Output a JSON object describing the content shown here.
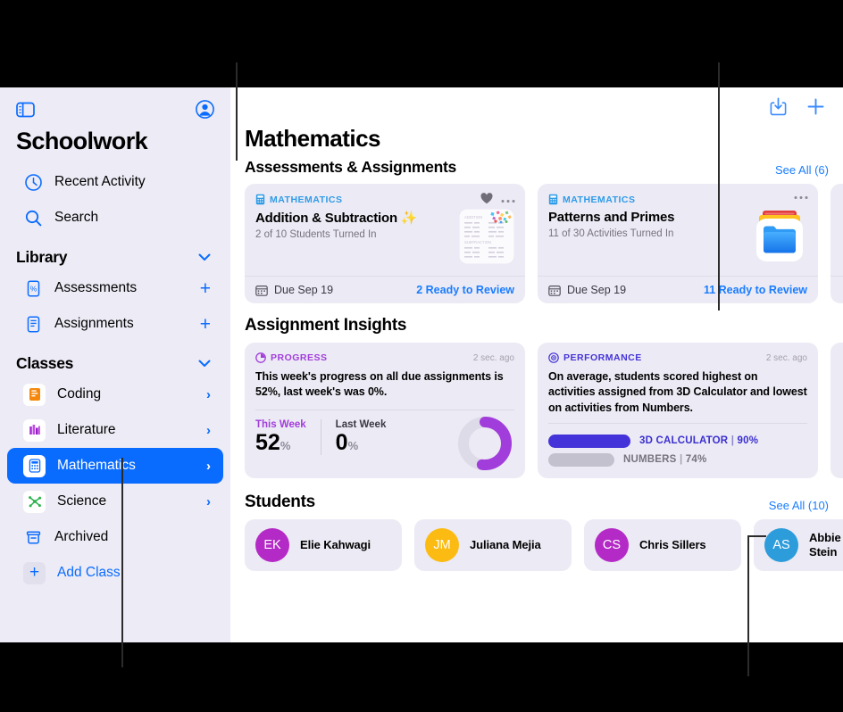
{
  "sidebar": {
    "app_title": "Schoolwork",
    "toggle_icon": "sidebar-toggle-icon",
    "account_icon": "account-circle-icon",
    "quick_items": [
      {
        "label": "Recent Activity",
        "icon": "clock-icon"
      },
      {
        "label": "Search",
        "icon": "search-icon"
      }
    ],
    "library": {
      "header": "Library",
      "items": [
        {
          "label": "Assessments",
          "icon": "assessment-percent-icon",
          "action": "+"
        },
        {
          "label": "Assignments",
          "icon": "assignment-doc-icon",
          "action": "+"
        }
      ]
    },
    "classes": {
      "header": "Classes",
      "items": [
        {
          "label": "Coding",
          "icon": "coding-icon",
          "selected": false,
          "chevron": "›"
        },
        {
          "label": "Literature",
          "icon": "literature-icon",
          "selected": false,
          "chevron": "›"
        },
        {
          "label": "Mathematics",
          "icon": "calculator-icon",
          "selected": true,
          "chevron": "›"
        },
        {
          "label": "Science",
          "icon": "science-molecule-icon",
          "selected": false,
          "chevron": "›"
        }
      ],
      "archived": {
        "label": "Archived",
        "icon": "archive-box-icon"
      },
      "add_class": {
        "label": "Add Class",
        "icon": "plus-icon"
      }
    }
  },
  "toolbar": {
    "export_icon": "import-download-icon",
    "add_icon": "plus-icon"
  },
  "main": {
    "page_title": "Mathematics",
    "sections": {
      "assignments": {
        "title": "Assessments & Assignments",
        "see_all": "See All (6)",
        "cards": [
          {
            "kicker": "MATHEMATICS",
            "kicker_icon": "calculator-icon",
            "title": "Addition & Subtraction ✨",
            "subtitle": "2 of 10 Students Turned In",
            "due": "Due Sep 19",
            "due_icon": "calendar-icon",
            "review": "2 Ready to Review",
            "favorited": true,
            "thumb": "worksheet-thumbnail"
          },
          {
            "kicker": "MATHEMATICS",
            "kicker_icon": "calculator-icon",
            "title": "Patterns and Primes",
            "subtitle": "11 of 30 Activities Turned In",
            "due": "Due Sep 19",
            "due_icon": "calendar-icon",
            "review": "11 Ready to Review",
            "favorited": false,
            "thumb": "folder-stack-thumbnail"
          }
        ]
      },
      "insights": {
        "title": "Assignment Insights",
        "progress": {
          "kicker": "PROGRESS",
          "kicker_icon": "progress-clock-icon",
          "timestamp": "2 sec. ago",
          "description": "This week's progress on all due assignments is 52%, last week's was 0%.",
          "this_week_label": "This Week",
          "this_week_value": "52",
          "last_week_label": "Last Week",
          "last_week_value": "0",
          "percent_symbol": "%",
          "donut_percent": 52,
          "accent_color": "#A13DDB"
        },
        "performance": {
          "kicker": "PERFORMANCE",
          "kicker_icon": "performance-target-icon",
          "timestamp": "2 sec. ago",
          "description": "On average, students scored highest on activities assigned from 3D Calculator and lowest on activities from Numbers.",
          "bars": [
            {
              "label": "3D CALCULATOR",
              "separator": "|",
              "value": "90%",
              "width": 92,
              "color": "#4433D8",
              "text_color": "#3A2FD0"
            },
            {
              "label": "NUMBERS",
              "separator": "|",
              "value": "74%",
              "width": 74,
              "color": "#C4C1CE",
              "text_color": "#77737F"
            }
          ]
        }
      },
      "students": {
        "title": "Students",
        "see_all": "See All (10)",
        "list": [
          {
            "initials": "EK",
            "name": "Elie Kahwagi",
            "color": "#B42AC6"
          },
          {
            "initials": "JM",
            "name": "Juliana Mejia",
            "color": "#FBBB12"
          },
          {
            "initials": "CS",
            "name": "Chris Sillers",
            "color": "#B42AC6"
          },
          {
            "initials": "AS",
            "name": "Abbie Stein",
            "color": "#2D9CDB"
          }
        ]
      }
    }
  }
}
